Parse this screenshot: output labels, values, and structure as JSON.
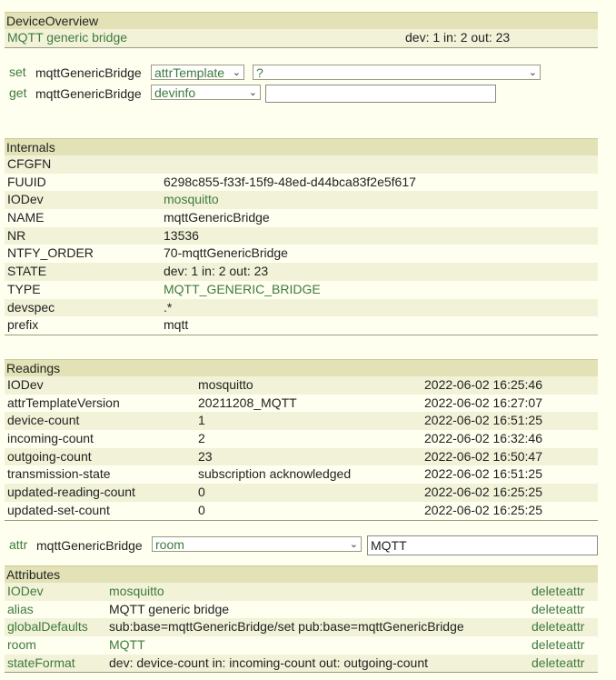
{
  "device_overview": {
    "header": "DeviceOverview",
    "alias": "MQTT generic bridge",
    "state": "dev: 1 in: 2 out: 23"
  },
  "commands": {
    "set_label": "set",
    "get_label": "get",
    "attr_label": "attr",
    "device_name": "mqttGenericBridge",
    "set_select": "attrTemplate",
    "set_value_select": "?",
    "get_select": "devinfo",
    "get_value": "",
    "attr_select": "room",
    "attr_value": "MQTT"
  },
  "internals": {
    "header": "Internals",
    "rows": [
      {
        "name": "CFGFN",
        "value": ""
      },
      {
        "name": "FUUID",
        "value": "6298c855-f33f-15f9-48ed-d44bca83f2e5f617"
      },
      {
        "name": "IODev",
        "value": "mosquitto"
      },
      {
        "name": "NAME",
        "value": "mqttGenericBridge"
      },
      {
        "name": "NR",
        "value": "13536"
      },
      {
        "name": "NTFY_ORDER",
        "value": "70-mqttGenericBridge"
      },
      {
        "name": "STATE",
        "value": "dev: 1 in: 2 out: 23"
      },
      {
        "name": "TYPE",
        "value": "MQTT_GENERIC_BRIDGE"
      },
      {
        "name": "devspec",
        "value": ".*"
      },
      {
        "name": "prefix",
        "value": "mqtt"
      }
    ]
  },
  "readings": {
    "header": "Readings",
    "rows": [
      {
        "name": "IODev",
        "value": "mosquitto",
        "time": "2022-06-02 16:25:46"
      },
      {
        "name": "attrTemplateVersion",
        "value": "20211208_MQTT",
        "time": "2022-06-02 16:27:07"
      },
      {
        "name": "device-count",
        "value": "1",
        "time": "2022-06-02 16:51:25"
      },
      {
        "name": "incoming-count",
        "value": "2",
        "time": "2022-06-02 16:32:46"
      },
      {
        "name": "outgoing-count",
        "value": "23",
        "time": "2022-06-02 16:50:47"
      },
      {
        "name": "transmission-state",
        "value": "subscription acknowledged",
        "time": "2022-06-02 16:51:25"
      },
      {
        "name": "updated-reading-count",
        "value": "0",
        "time": "2022-06-02 16:25:25"
      },
      {
        "name": "updated-set-count",
        "value": "0",
        "time": "2022-06-02 16:25:25"
      }
    ]
  },
  "attributes": {
    "header": "Attributes",
    "delete_label": "deleteattr",
    "rows": [
      {
        "name": "IODev",
        "value": "mosquitto"
      },
      {
        "name": "alias",
        "value": "MQTT generic bridge"
      },
      {
        "name": "globalDefaults",
        "value": "sub:base=mqttGenericBridge/set pub:base=mqttGenericBridge"
      },
      {
        "name": "room",
        "value": "MQTT"
      },
      {
        "name": "stateFormat",
        "value": "dev: device-count in: incoming-count out: outgoing-count"
      }
    ]
  }
}
